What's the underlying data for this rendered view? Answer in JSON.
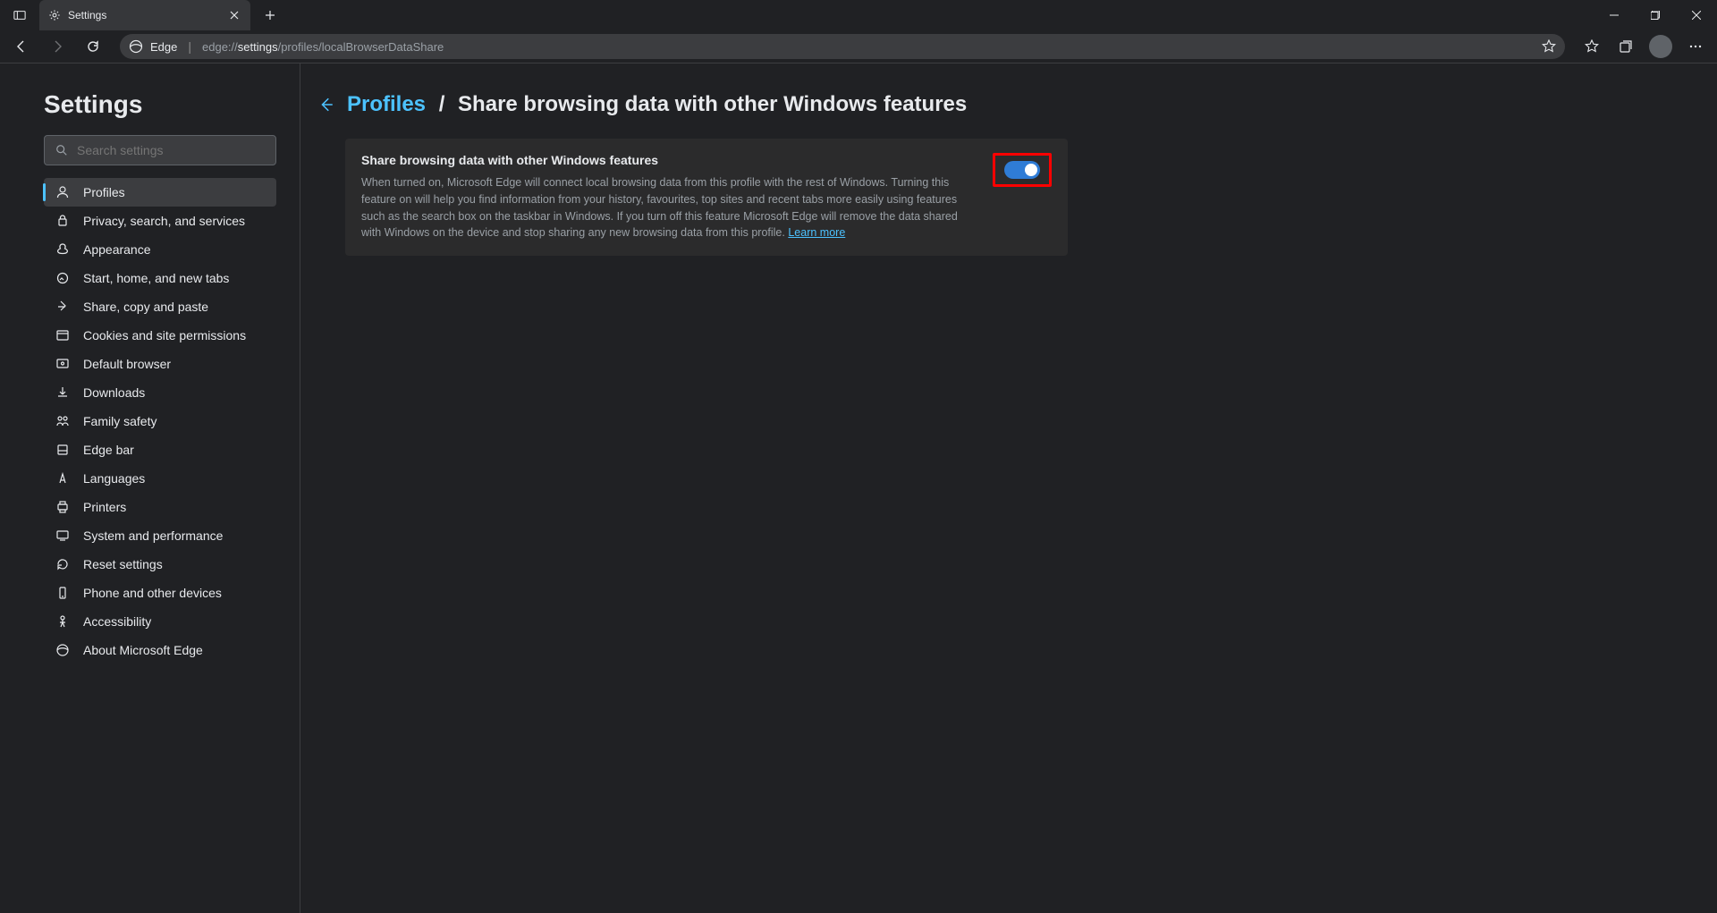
{
  "tab": {
    "title": "Settings"
  },
  "addressbar": {
    "site_label": "Edge",
    "url_prefix": "edge://",
    "url_bold": "settings",
    "url_suffix": "/profiles/localBrowserDataShare"
  },
  "sidebar": {
    "title": "Settings",
    "search_placeholder": "Search settings",
    "items": [
      {
        "label": "Profiles",
        "active": true
      },
      {
        "label": "Privacy, search, and services"
      },
      {
        "label": "Appearance"
      },
      {
        "label": "Start, home, and new tabs"
      },
      {
        "label": "Share, copy and paste"
      },
      {
        "label": "Cookies and site permissions"
      },
      {
        "label": "Default browser"
      },
      {
        "label": "Downloads"
      },
      {
        "label": "Family safety"
      },
      {
        "label": "Edge bar"
      },
      {
        "label": "Languages"
      },
      {
        "label": "Printers"
      },
      {
        "label": "System and performance"
      },
      {
        "label": "Reset settings"
      },
      {
        "label": "Phone and other devices"
      },
      {
        "label": "Accessibility"
      },
      {
        "label": "About Microsoft Edge"
      }
    ]
  },
  "breadcrumb": {
    "parent": "Profiles",
    "separator": "/",
    "current": "Share browsing data with other Windows features"
  },
  "card": {
    "title": "Share browsing data with other Windows features",
    "description": "When turned on, Microsoft Edge will connect local browsing data from this profile with the rest of Windows. Turning this feature on will help you find information from your history, favourites, top sites and recent tabs more easily using features such as the search box on the taskbar in Windows. If you turn off this feature Microsoft Edge will remove the data shared with Windows on the device and stop sharing any new browsing data from this profile.",
    "learn_more": "Learn more",
    "toggle_on": true
  }
}
